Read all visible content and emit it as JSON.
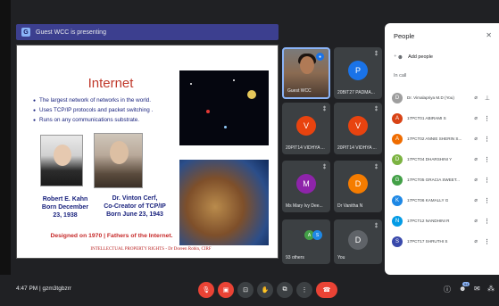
{
  "presenting_banner": {
    "text": "Guest WCC is presenting",
    "icon": "pin-icon"
  },
  "slide": {
    "title": "Internet",
    "bullets": [
      "The largest network of networks in the world.",
      "Uses TCP/IP protocols and packet switching .",
      "Runs on any communications substrate."
    ],
    "person1_caption": [
      "Robert E. Kahn",
      "Born December",
      "23, 1938"
    ],
    "person2_caption": [
      "Dr. Vinton Cerf,",
      "Co-Creator of TCP/IP",
      "Born June 23, 1943"
    ],
    "designed_line": "Designed on 1970 | Fathers of the Internet.",
    "footer": "INTELLECTUAL PROPERTY RIGHTS - Dr Doreen Robin, CIRF"
  },
  "tiles": [
    {
      "name": "Guest WCC",
      "kind": "video"
    },
    {
      "name": "20BIT27 PADMA...",
      "initial": "P",
      "color": "#1a73e8"
    },
    {
      "name": "20PIT14 VIDHYA ...",
      "initial": "V",
      "color": "#e8430f"
    },
    {
      "name": "20PIT14 VIDHYA ...",
      "initial": "V",
      "color": "#e8430f"
    },
    {
      "name": "Ms Mary Ivy Dee...",
      "initial": "M",
      "color": "#8e24aa"
    },
    {
      "name": "Dr Vanitha N",
      "initial": "D",
      "color": "#f57c00"
    },
    {
      "name": "93 others",
      "mini": [
        {
          "initial": "A",
          "color": "#43a047"
        },
        {
          "initial": "S",
          "color": "#1e88e5"
        }
      ]
    },
    {
      "name": "You",
      "initial": "D",
      "color": "#5f6368"
    }
  ],
  "people": {
    "title": "People",
    "add_label": "Add people",
    "section_label": "In call",
    "rows": [
      {
        "initial": "D",
        "name": "Dr. Vimalapriya M.D (You)",
        "color": "#9e9e9e"
      },
      {
        "initial": "A",
        "name": "17PCT01 ABIRAMI S",
        "color": "#d84315"
      },
      {
        "initial": "A",
        "name": "17PCT02 ANNIE SHERIN S...",
        "color": "#ef6c00"
      },
      {
        "initial": "D",
        "name": "17PCT04 DHARSHINI Y",
        "color": "#7cb342"
      },
      {
        "initial": "G",
        "name": "17PCT05 GRACIA SWEET...",
        "color": "#43a047"
      },
      {
        "initial": "K",
        "name": "17PCT06 KAMALLY G",
        "color": "#1e88e5"
      },
      {
        "initial": "N",
        "name": "17PCT12 NANDHINI R",
        "color": "#039be5"
      },
      {
        "initial": "S",
        "name": "17PCT17 SHRUTHI S",
        "color": "#3949ab"
      }
    ]
  },
  "bottom": {
    "time_code": "4:47 PM | gzm3tgbzrr",
    "people_count": "94"
  }
}
